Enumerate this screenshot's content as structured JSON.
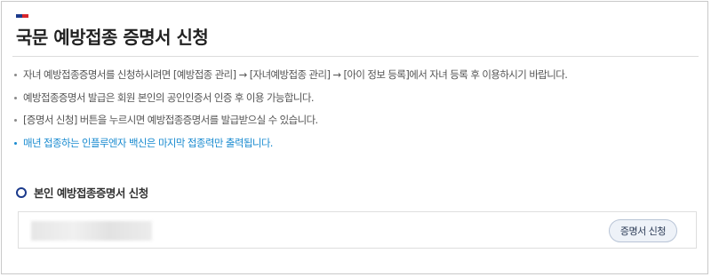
{
  "page": {
    "title": "국문 예방접종 증명서 신청"
  },
  "notices": [
    {
      "text": "자녀 예방접종증명서를 신청하시려면 [예방접종 관리] → [자녀예방접종 관리] → [아이 정보 등록]에서 자녀 등록 후 이용하시기 바랍니다.",
      "highlight": false
    },
    {
      "text": "예방접종증명서 발급은 회원 본인의 공인인증서 인증 후 이용 가능합니다.",
      "highlight": false
    },
    {
      "text": "[증명서 신청] 버튼을 누르시면 예방접종증명서를 발급받으실 수 있습니다.",
      "highlight": false
    },
    {
      "text": "매년 접종하는 인플루엔자 백신은 마지막 접종력만 출력됩니다.",
      "highlight": true
    }
  ],
  "section": {
    "title": "본인 예방접종증명서 신청"
  },
  "apply": {
    "button_label": "증명서 신청"
  },
  "colors": {
    "accent_navy": "#1b3a8c",
    "accent_red": "#d8262c",
    "highlight_blue": "#1a8bd0"
  }
}
